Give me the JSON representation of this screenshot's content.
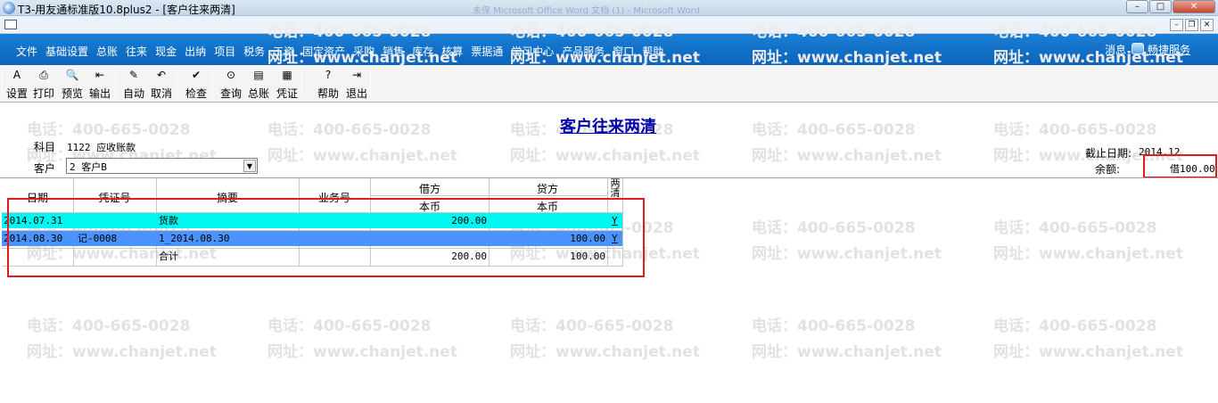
{
  "window": {
    "title": "T3-用友通标准版10.8plus2 - [客户往来两清]",
    "ghost_title": "未保 Microsoft Office Word 文档 (1) - Microsoft Word",
    "minimize": "–",
    "maximize": "□",
    "close": "✕",
    "child_minimize": "–",
    "child_restore": "❐",
    "child_close": "✕"
  },
  "menu": {
    "items": [
      "文件",
      "基础设置",
      "总账",
      "往来",
      "现金",
      "出纳",
      "项目",
      "税务",
      "工资",
      "固定资产",
      "采购",
      "销售",
      "库存",
      "核算",
      "票据通",
      "学习中心",
      "产品服务",
      "窗口",
      "帮助"
    ],
    "message_label": "消息",
    "service_label": "畅捷服务"
  },
  "toolbar": [
    {
      "label": "设置",
      "icon": "settings-icon",
      "glyph": "A"
    },
    {
      "label": "打印",
      "icon": "printer-icon",
      "glyph": "⎙"
    },
    {
      "label": "预览",
      "icon": "preview-icon",
      "glyph": "🔍"
    },
    {
      "label": "输出",
      "icon": "export-icon",
      "glyph": "⇤"
    },
    {
      "label": "自动",
      "icon": "auto-icon",
      "glyph": "✎"
    },
    {
      "label": "取消",
      "icon": "undo-icon",
      "glyph": "↶"
    },
    {
      "label": "检查",
      "icon": "check-icon",
      "glyph": "✔"
    },
    {
      "label": "查询",
      "icon": "binoculars-icon",
      "glyph": "⊙"
    },
    {
      "label": "总账",
      "icon": "ledger-icon",
      "glyph": "▤"
    },
    {
      "label": "凭证",
      "icon": "voucher-icon",
      "glyph": "▦"
    },
    {
      "label": "帮助",
      "icon": "help-icon",
      "glyph": "?"
    },
    {
      "label": "退出",
      "icon": "exit-icon",
      "glyph": "⇥"
    }
  ],
  "watermark": {
    "phone": "电话：400-665-0028",
    "url": "网址：www.chanjet.net"
  },
  "report": {
    "title": "客户往来两清",
    "subject_label": "科目",
    "subject_value": "1122 应收账款",
    "customer_label": "客户",
    "customer_value": "2  客户B",
    "cutoff_label": "截止日期:",
    "cutoff_value": "2014.12",
    "balance_label": "余额:",
    "balance_value": "借100.00"
  },
  "table": {
    "headers": {
      "date": "日期",
      "voucher": "凭证号",
      "summary": "摘要",
      "business": "业务号",
      "debit": "借方",
      "credit": "贷方",
      "debit_sub": "本币",
      "credit_sub": "本币",
      "cleared": "两清"
    },
    "rows": [
      {
        "date": "2014.07.31",
        "voucher": "",
        "summary": "货款",
        "business": "",
        "debit": "200.00",
        "credit": "",
        "cleared": "Y"
      },
      {
        "date": "2014.08.30",
        "voucher": "记-0008",
        "summary": "1_2014.08.30",
        "business": "",
        "debit": "",
        "credit": "100.00",
        "cleared": "Y"
      },
      {
        "date": "",
        "voucher": "",
        "summary": "合计",
        "business": "",
        "debit": "200.00",
        "credit": "100.00",
        "cleared": ""
      }
    ]
  },
  "colors": {
    "menubar": "#1272c9",
    "row_highlight_cyan": "#00f6f0",
    "row_highlight_blue": "#4b93ff",
    "annotation_red": "#e11b1b",
    "title_blue": "#0000aa"
  }
}
